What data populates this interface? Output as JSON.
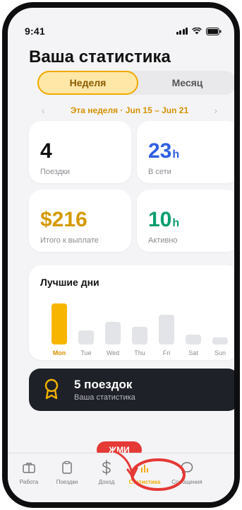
{
  "status": {
    "time": "9:41"
  },
  "page_title": "Ваша статистика",
  "segment": {
    "week": "Неделя",
    "month": "Месяц",
    "selected": "week"
  },
  "week_nav": {
    "prev": "‹",
    "label": "Эта неделя · Jun 15 – Jun 21",
    "next": "›"
  },
  "stats": [
    {
      "value": "4",
      "unit": "",
      "label": "Поездки",
      "color": "#111111"
    },
    {
      "value": "23",
      "unit": "h",
      "label": "В сети",
      "color": "#2f5fe0"
    },
    {
      "value": "$216",
      "unit": "",
      "label": "Итого к выплате",
      "color": "#d49a00"
    },
    {
      "value": "10",
      "unit": "h",
      "label": "Активно",
      "color": "#0a9e70"
    }
  ],
  "best_days": {
    "title": "Лучшие дни",
    "chart_data": {
      "type": "bar",
      "categories": [
        "Mon",
        "Tue",
        "Wed",
        "Thu",
        "Fri",
        "Sat",
        "Sun"
      ],
      "values": [
        58,
        20,
        32,
        25,
        42,
        14,
        10
      ],
      "highlight": "Mon",
      "highlight_color": "#f7b500",
      "bar_color": "#e3e4e8"
    }
  },
  "banner": {
    "title": "5 поездок",
    "subtitle": "Ваша статистика"
  },
  "tooltip": {
    "text": "ЖМИ"
  },
  "tabs": [
    {
      "label": "Работа",
      "icon": "briefcase-icon"
    },
    {
      "label": "Поездки",
      "icon": "clipboard-icon"
    },
    {
      "label": "Доход",
      "icon": "dollar-icon"
    },
    {
      "label": "Статистика",
      "icon": "bar-chart-icon",
      "active": true
    },
    {
      "label": "Сообщения",
      "icon": "chat-bubble-icon"
    }
  ],
  "colors": {
    "accent": "#f2a900",
    "highlight_ring": "#e53935",
    "banner_bg": "#1f2128"
  }
}
